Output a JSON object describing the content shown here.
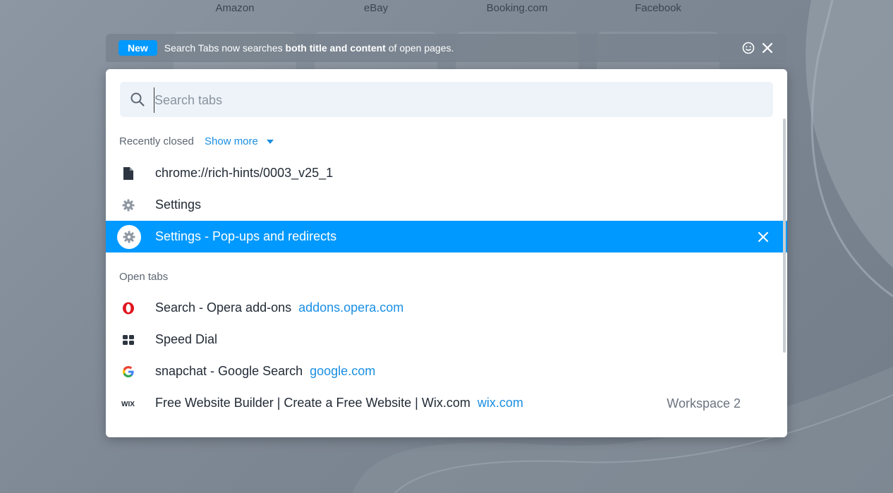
{
  "speed_dial": {
    "labels": [
      "Amazon",
      "eBay",
      "Booking.com",
      "Facebook"
    ]
  },
  "notification": {
    "badge": "New",
    "text_before": "Search Tabs now searches ",
    "text_bold": "both title and content",
    "text_after": " of open pages."
  },
  "search": {
    "placeholder": "Search tabs",
    "value": ""
  },
  "recently_closed": {
    "title": "Recently closed",
    "show_more": "Show more",
    "items": [
      {
        "title": "chrome://rich-hints/0003_v25_1",
        "icon": "document-icon"
      },
      {
        "title": "Settings",
        "icon": "gear-icon"
      },
      {
        "title": "Settings - Pop-ups and redirects",
        "icon": "gear-icon",
        "selected": true
      }
    ]
  },
  "open_tabs": {
    "title": "Open tabs",
    "items": [
      {
        "title": "Search - Opera add-ons",
        "url": "addons.opera.com",
        "icon": "opera-icon"
      },
      {
        "title": "Speed Dial",
        "url": "",
        "icon": "speed-dial-icon"
      },
      {
        "title": "snapchat - Google Search",
        "url": "google.com",
        "icon": "google-icon"
      },
      {
        "title": "Free Website Builder | Create a Free Website | Wix.com",
        "url": "wix.com",
        "icon": "wix-icon",
        "workspace": "Workspace 2"
      }
    ]
  },
  "colors": {
    "accent": "#0099ff",
    "link": "#1a8fe3",
    "panel_bg": "#ffffff"
  }
}
